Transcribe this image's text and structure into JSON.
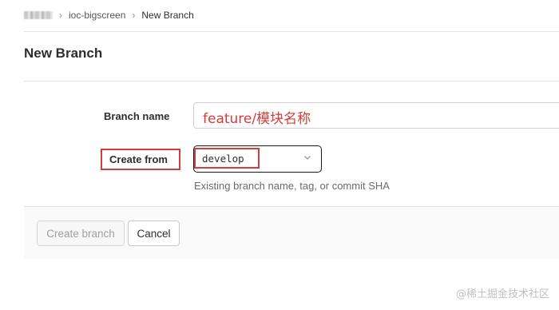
{
  "breadcrumb": {
    "project": "ioc-bigscreen",
    "current": "New Branch",
    "separator": "›"
  },
  "page": {
    "title": "New Branch"
  },
  "form": {
    "branch_name_label": "Branch name",
    "branch_name_value": "feature/模块名称",
    "create_from_label": "Create from",
    "create_from_value": "develop",
    "create_from_help": "Existing branch name, tag, or commit SHA"
  },
  "actions": {
    "create_label": "Create branch",
    "cancel_label": "Cancel"
  },
  "watermark": "@稀土掘金技术社区",
  "colors": {
    "annotation_red": "#d33c3c",
    "text": "#2e2e2e",
    "muted": "#6b6b6b",
    "border": "#e5e5e5"
  },
  "icons": {
    "select_indicator": "chevron-down-icon",
    "redacted_namespace": "blurred-group-name"
  }
}
